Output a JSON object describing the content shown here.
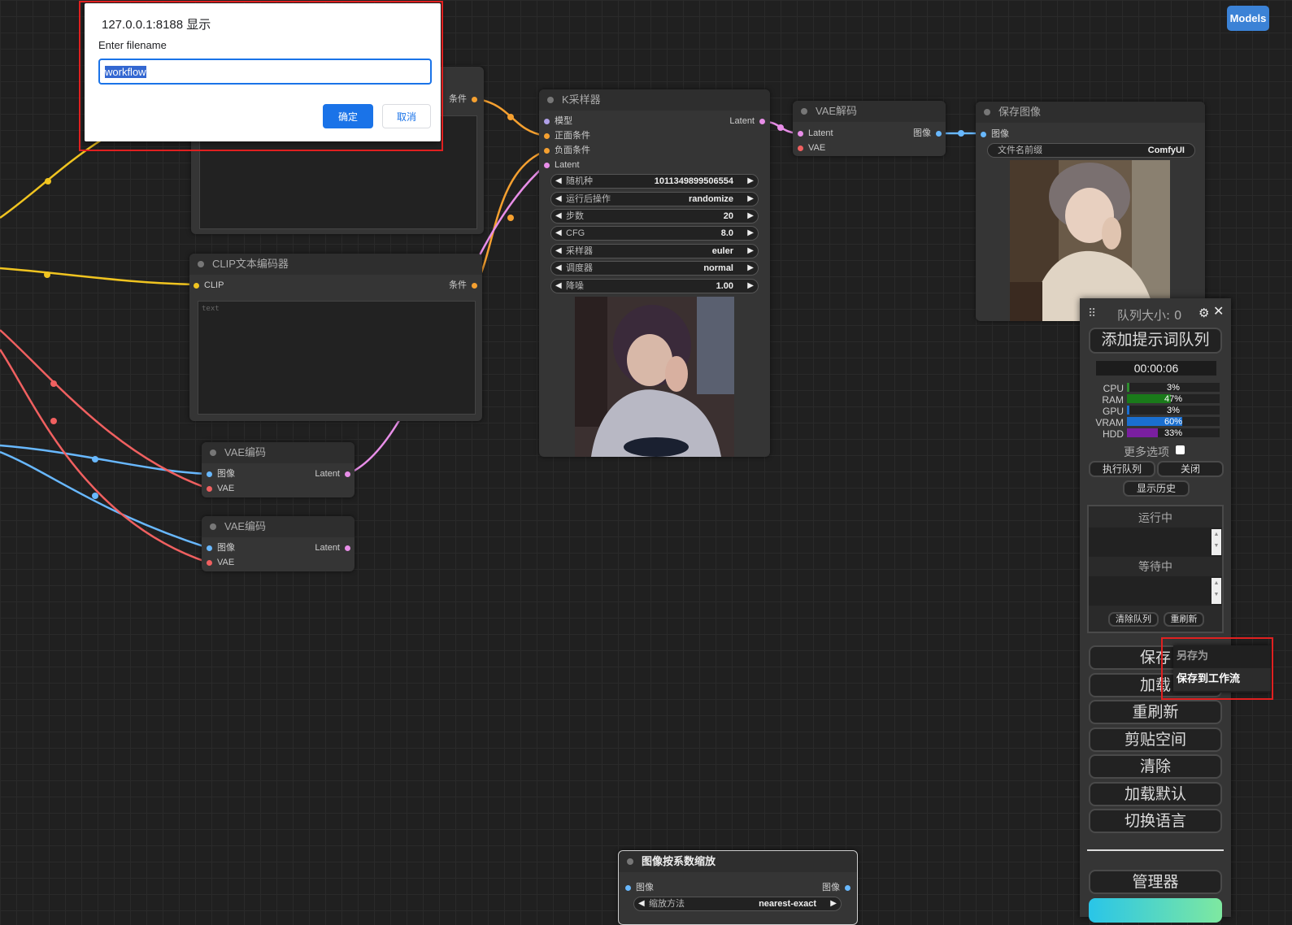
{
  "dialog": {
    "title": "127.0.0.1:8188 显示",
    "message": "Enter filename",
    "value": "workflow",
    "ok": "确定",
    "cancel": "取消"
  },
  "top_right": {
    "models": "Models"
  },
  "clip_top": {
    "out_label": "条件"
  },
  "clip2": {
    "title": "CLIP文本编码器",
    "in": "CLIP",
    "out": "条件",
    "placeholder": "text"
  },
  "ksampler": {
    "title": "K采样器",
    "inputs": [
      "模型",
      "正面条件",
      "负面条件",
      "Latent"
    ],
    "output": "Latent",
    "widgets": [
      {
        "label": "随机种",
        "value": "1011349899506554"
      },
      {
        "label": "运行后操作",
        "value": "randomize"
      },
      {
        "label": "步数",
        "value": "20"
      },
      {
        "label": "CFG",
        "value": "8.0"
      },
      {
        "label": "采样器",
        "value": "euler"
      },
      {
        "label": "调度器",
        "value": "normal"
      },
      {
        "label": "降噪",
        "value": "1.00"
      }
    ]
  },
  "vae_decode": {
    "title": "VAE解码",
    "in1": "Latent",
    "in2": "VAE",
    "out": "图像"
  },
  "save_image": {
    "title": "保存图像",
    "in": "图像",
    "widget_label": "文件名前缀",
    "widget_value": "ComfyUI"
  },
  "vae_encode1": {
    "title": "VAE编码",
    "in1": "图像",
    "in2": "VAE",
    "out": "Latent"
  },
  "vae_encode2": {
    "title": "VAE编码",
    "in1": "图像",
    "in2": "VAE",
    "out": "Latent"
  },
  "scale_node": {
    "title": "图像按系数缩放",
    "in": "图像",
    "out": "图像",
    "widget_label": "缩放方法",
    "widget_value": "nearest-exact"
  },
  "menu": {
    "queue_size": "队列大小: 0",
    "queue_prompt": "添加提示词队列",
    "timer": "00:00:06",
    "stats": [
      {
        "label": "CPU",
        "value": "3%",
        "fill": 0.03,
        "color": "#2e8b2e"
      },
      {
        "label": "RAM",
        "value": "47%",
        "fill": 0.47,
        "color": "#1a7a1a"
      },
      {
        "label": "GPU",
        "value": "3%",
        "fill": 0.03,
        "color": "#1a6fd0"
      },
      {
        "label": "VRAM",
        "value": "60%",
        "fill": 0.6,
        "color": "#1a6fd0"
      },
      {
        "label": "HDD",
        "value": "33%",
        "fill": 0.33,
        "color": "#7a1fa0"
      }
    ],
    "more_options": "更多选项",
    "exec_queue": "执行队列",
    "close": "关闭",
    "show_history": "显示历史",
    "running": "运行中",
    "pending": "等待中",
    "clear_queue": "清除队列",
    "refresh_small": "重刷新",
    "save": "保存",
    "load": "加载",
    "refresh": "重刷新",
    "clipspace": "剪贴空间",
    "clear": "清除",
    "load_default": "加载默认",
    "switch_lang": "切换语言",
    "manager": "管理器"
  },
  "context_menu": {
    "save_as": "另存为",
    "save_to_workflow": "保存到工作流"
  }
}
